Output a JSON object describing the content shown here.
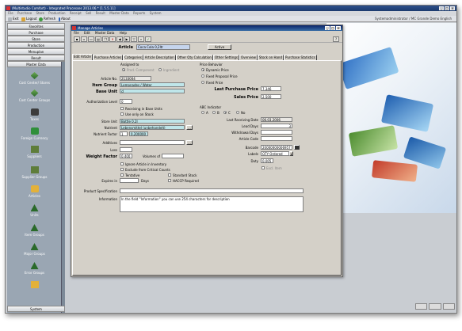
{
  "app": {
    "title": "(Multistudio Comfort) - Integrated Processes 2013.06.* [1.5.5.11]",
    "window_controls": [
      "_",
      "□",
      "×"
    ]
  },
  "menubar": [
    "File",
    "Purchase",
    "Store",
    "Production",
    "Receipt",
    "Sell",
    "Result",
    "Master Data",
    "Reports",
    "System"
  ],
  "toolbar": {
    "exit": "Exit",
    "logout": "Logout",
    "refresh": "Refresh",
    "about": "About",
    "right_text": "Systemadministrator / MC Grande Demo English"
  },
  "sidebar": {
    "headers": [
      "Favorites",
      "Purchase",
      "Store",
      "Production",
      "Menuplan",
      "Result",
      "Master Data"
    ],
    "items": [
      {
        "label": "Cost Center/ Stores",
        "icon": "cost-center-icon"
      },
      {
        "label": "Cost Center Groups",
        "icon": "cost-center-groups-icon"
      },
      {
        "label": "Taxes",
        "icon": "taxes-icon"
      },
      {
        "label": "Foreign Currency",
        "icon": "foreign-currency-icon"
      },
      {
        "label": "Suppliers",
        "icon": "suppliers-icon"
      },
      {
        "label": "Supplier Groups",
        "icon": "supplier-groups-icon"
      },
      {
        "label": "Articles",
        "icon": "articles-icon"
      },
      {
        "label": "Units",
        "icon": "units-icon"
      },
      {
        "label": "Item Groups",
        "icon": "item-groups-icon"
      },
      {
        "label": "Major Groups",
        "icon": "major-groups-icon"
      },
      {
        "label": "Error Groups",
        "icon": "error-groups-icon"
      }
    ],
    "system": "System"
  },
  "child_window": {
    "title": "Manage Articles",
    "menu": [
      "File",
      "Edit",
      "Master Data",
      "Help"
    ],
    "article_label": "Article",
    "article_value": "Coca Cola 0,2ltr",
    "active_button": "Active",
    "tabs": [
      "Edit Article",
      "Purchase Articles",
      "Categories",
      "Article Description",
      "Other Qty Calculation",
      "Other Settings",
      "Overview",
      "Stock on Hand",
      "Purchase Statistics"
    ],
    "left": {
      "assigned_to": "Assigned to",
      "prod_component": "Prod. Component",
      "ingredient": "Ingredient",
      "article_no_label": "Article No.",
      "article_no_value": "2133004",
      "item_group_label": "Item Group",
      "item_group_value": "Lemonades / Water",
      "base_unit_label": "Base Unit",
      "base_unit_value": "cl",
      "auth_level_label": "Authorization Level",
      "auth_level_value": "0",
      "receiving_in_base": "Receiving in Base Units",
      "use_only_on_stock": "Use only on Stock",
      "store_unit_label": "Store Unit",
      "store_unit_value": "Bottle 0,2l",
      "nutrient_label": "Nutrient",
      "nutrient_value": "Lebensmittel (unbehandelt)",
      "nutrient_factor_label": "Nutrient Factor",
      "nutrient_factor_1": "1",
      "nutrient_factor_2": "0,200000",
      "additives_label": "Additives",
      "loss_label": "Loss",
      "weight_factor_label": "Weight Factor",
      "weight_factor_value": "0.400",
      "volumes_label": "Volumes of",
      "ignore_inventory": "Ignore Article in Inventory",
      "exclude_critical": "Exclude from Critical Counts",
      "tentative": "Tentative",
      "standard_stock": "Standard Stock",
      "expires_in_label": "Expires in",
      "days_label": "Days",
      "haccp": "HACCP Required",
      "product_spec_label": "Product Specification",
      "information_label": "Information",
      "information_value": "In the field \"Information\" you can use 254 characters for description"
    },
    "right": {
      "price_behavior": "Price Behavior",
      "dynamic_price": "Dynamic Price",
      "fixed_proposal": "Fixed Proposal Price",
      "fixed_price": "Fixed Price",
      "last_purchase_label": "Last Purchase Price",
      "last_purchase_value": "7,346",
      "sales_price_label": "Sales Price",
      "sales_price_value": "2,500",
      "abc_label": "ABC Indicator",
      "abc_a": "A",
      "abc_b": "B",
      "abc_c": "C",
      "abc_no": "No",
      "last_receiving_label": "Last Receiving Date",
      "last_receiving_value": "06.03.2006",
      "lead_days_label": "Lead Days",
      "lead_days_value": "3",
      "withdrawal_days_label": "Withdrawal Days",
      "article_code_label": "Article Code",
      "barcode_label": "Barcode",
      "barcode_value": "20000000006957",
      "labels_label": "Labels",
      "labels_value": "QTY Ordered",
      "duty_label": "Duty",
      "duty_value": "0.005",
      "excl_item": "Excl. Item"
    }
  }
}
